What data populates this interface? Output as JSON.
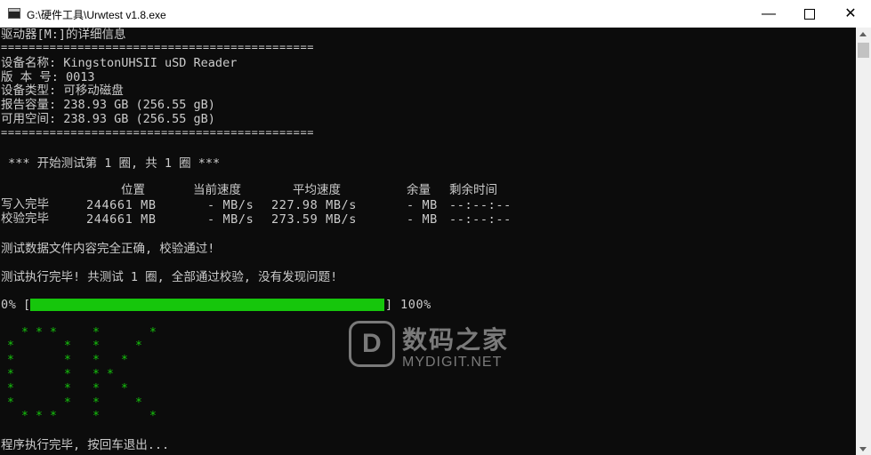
{
  "window": {
    "title": "G:\\硬件工具\\Urwtest v1.8.exe",
    "minimize_glyph": "—",
    "close_glyph": "✕"
  },
  "console": {
    "header": "驱动器[M:]的详细信息",
    "rule": "=============================================",
    "device_name": "设备名称: KingstonUHSII uSD Reader",
    "version": "版 本 号: 0013",
    "device_type": "设备类型: 可移动磁盘",
    "reported_capacity": "报告容量: 238.93 GB (256.55 gB)",
    "free_space": "可用空间: 238.93 GB (256.55 gB)",
    "start_test": " *** 开始测试第 1 圈, 共 1 圈 ***",
    "table": {
      "headers": [
        "位置",
        "当前速度",
        "平均速度",
        "余量",
        "剩余时间"
      ],
      "rows": [
        {
          "label": "写入完毕",
          "position": "244661 MB",
          "current": "- MB/s",
          "average": "227.98 MB/s",
          "remaining": "- MB",
          "time_left": "--:--:--"
        },
        {
          "label": "校验完毕",
          "position": "244661 MB",
          "current": "- MB/s",
          "average": "273.59 MB/s",
          "remaining": "- MB",
          "time_left": "--:--:--"
        }
      ]
    },
    "verify_ok": "测试数据文件内容完全正确, 校验通过!",
    "finished": "测试执行完毕! 共测试 1 圈, 全部通过校验, 没有发现问题!",
    "progress": {
      "start_label": "0%",
      "open_bracket": "[",
      "close_bracket": "]",
      "end_label": "100%",
      "value": 1.0
    },
    "ok_star": "*",
    "exit_prompt": "程序执行完毕, 按回车退出..."
  },
  "watermark": {
    "cn": "数码之家",
    "en": "MYDIGIT.NET"
  },
  "colors": {
    "console_bg": "#0c0c0c",
    "console_text": "#cccccc",
    "progress_green": "#16c60c"
  }
}
